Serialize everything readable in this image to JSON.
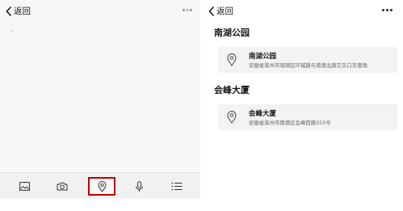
{
  "colors": {
    "highlight_border": "#c00000",
    "toolbar_bg": "#f1f1f1",
    "card_bg": "#f3f3f3"
  },
  "left_screen": {
    "back_label": "返回",
    "more_icon": "more-dots-icon",
    "toolbar": {
      "items": [
        {
          "name": "image",
          "icon": "image-icon"
        },
        {
          "name": "camera",
          "icon": "camera-icon"
        },
        {
          "name": "location",
          "icon": "location-pin-icon",
          "highlighted": true
        },
        {
          "name": "voice",
          "icon": "microphone-icon"
        },
        {
          "name": "list",
          "icon": "list-icon"
        }
      ]
    }
  },
  "right_screen": {
    "back_label": "返回",
    "more_icon": "more-dots-icon",
    "sections": [
      {
        "title": "南湖公园",
        "place": {
          "name": "南湖公园",
          "address": "安徽省滁州市琅琊区环城路与南谯北路交叉口东南角"
        }
      },
      {
        "title": "会峰大厦",
        "place": {
          "name": "会峰大厦",
          "address": "安徽省滁州市南谯区会峰西路555号"
        }
      }
    ]
  }
}
